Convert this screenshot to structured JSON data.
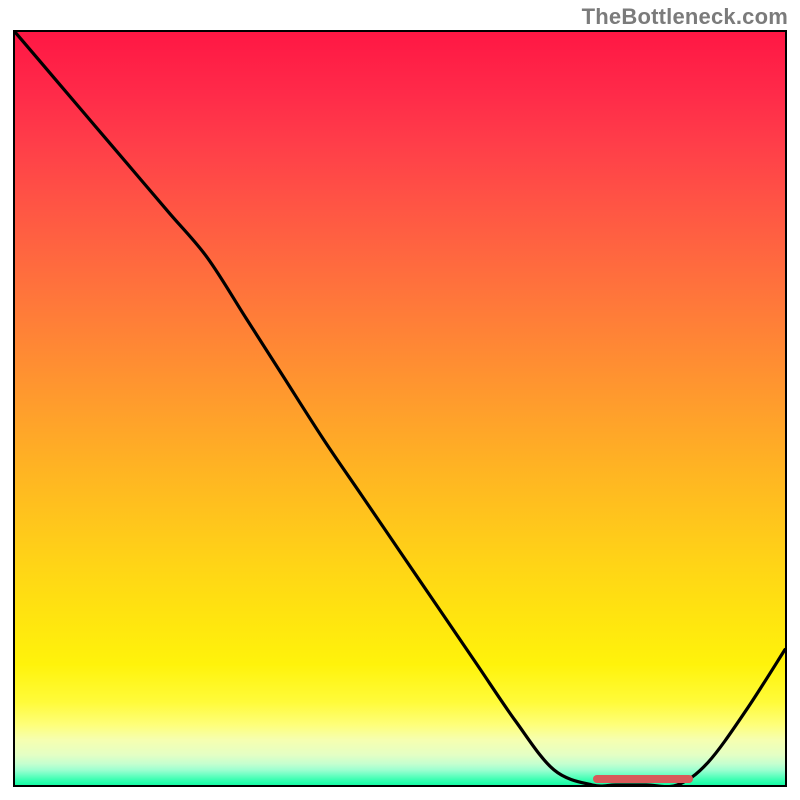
{
  "attribution": "TheBottleneck.com",
  "colors": {
    "gradient_top": "#ff1744",
    "gradient_bottom": "#14fca4",
    "curve": "#000000",
    "marker": "#d85a5a",
    "frame": "#000000"
  },
  "chart_data": {
    "type": "line",
    "title": "",
    "xlabel": "",
    "ylabel": "",
    "xlim": [
      0,
      100
    ],
    "ylim": [
      0,
      100
    ],
    "grid": false,
    "legend": false,
    "series": [
      {
        "name": "bottleneck-curve",
        "x": [
          0,
          5,
          10,
          15,
          20,
          25,
          30,
          35,
          40,
          45,
          50,
          55,
          60,
          65,
          70,
          75,
          78,
          82,
          86,
          90,
          95,
          100
        ],
        "y": [
          100,
          94,
          88,
          82,
          76,
          70,
          62,
          54,
          46,
          38.5,
          31,
          23.5,
          16,
          8.5,
          2,
          0,
          0,
          0,
          0,
          3,
          10,
          18
        ]
      }
    ],
    "annotations": [
      {
        "name": "optimal-flat-region",
        "type": "segment",
        "x_start": 75,
        "x_end": 88,
        "y": 0.8
      }
    ],
    "background": {
      "type": "vertical-gradient",
      "meaning": "red-high to green-low bottleneck severity"
    }
  }
}
